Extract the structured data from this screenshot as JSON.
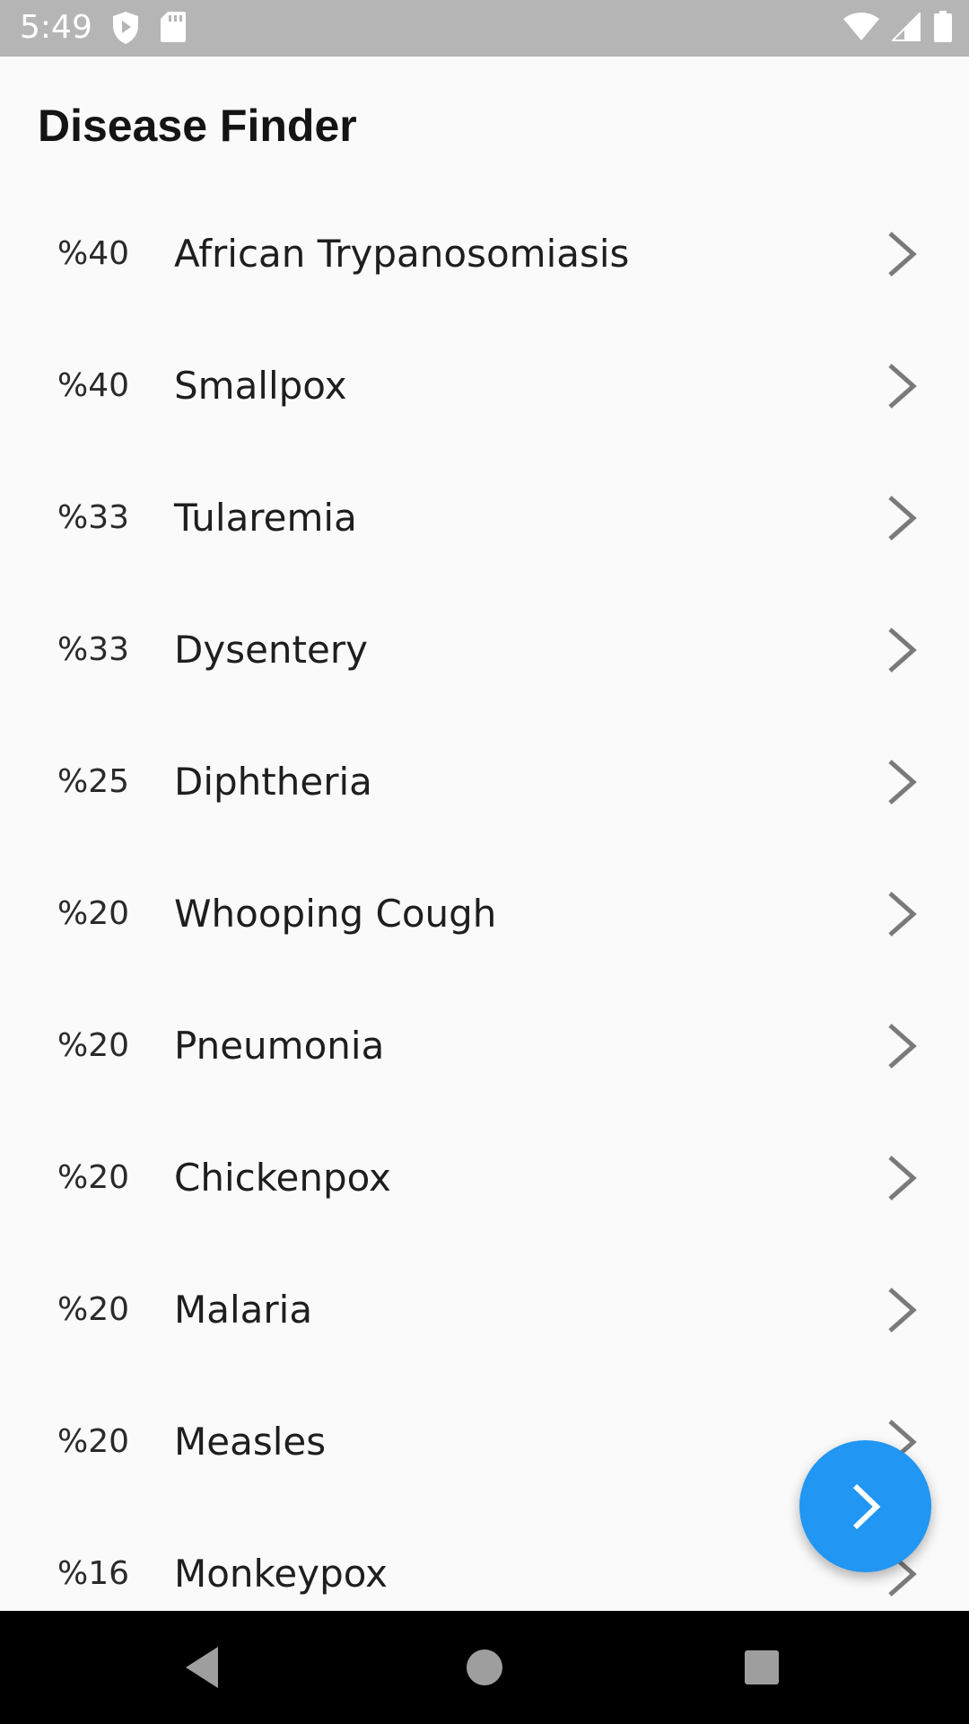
{
  "status_bar": {
    "time": "5:49",
    "icons": [
      "shield-play-icon",
      "sd-card-icon",
      "wifi-icon",
      "cell-signal-icon",
      "battery-icon"
    ]
  },
  "app_bar": {
    "title": "Disease Finder"
  },
  "colors": {
    "status_bar_bg": "#b5b5b5",
    "background": "#fafafa",
    "fab": "#2196f3",
    "chevron": "#7a7a7a",
    "nav_bar_bg": "#000000"
  },
  "diseases": [
    {
      "percent": "%40",
      "name": "African Trypanosomiasis"
    },
    {
      "percent": "%40",
      "name": "Smallpox"
    },
    {
      "percent": "%33",
      "name": "Tularemia"
    },
    {
      "percent": "%33",
      "name": "Dysentery"
    },
    {
      "percent": "%25",
      "name": "Diphtheria"
    },
    {
      "percent": "%20",
      "name": "Whooping Cough"
    },
    {
      "percent": "%20",
      "name": "Pneumonia"
    },
    {
      "percent": "%20",
      "name": "Chickenpox"
    },
    {
      "percent": "%20",
      "name": "Malaria"
    },
    {
      "percent": "%20",
      "name": "Measles"
    },
    {
      "percent": "%16",
      "name": "Monkeypox"
    }
  ],
  "fab": {
    "icon": "chevron-right-icon"
  },
  "nav_bar": {
    "buttons": [
      "back-triangle-icon",
      "home-circle-icon",
      "recents-square-icon"
    ]
  }
}
